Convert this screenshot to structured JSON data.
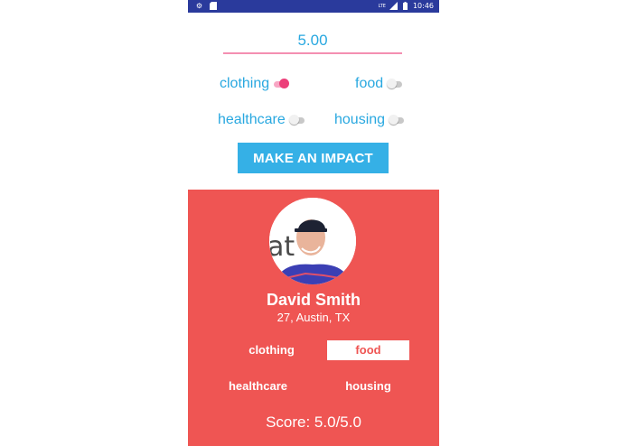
{
  "status_bar": {
    "time": "10:46",
    "left_icons": [
      "gear-icon",
      "sd-card-icon"
    ],
    "right_icons": [
      "lte-signal-icon",
      "battery-icon"
    ],
    "network_label": "LTE"
  },
  "form": {
    "amount_value": "5.00",
    "toggles": [
      {
        "label": "clothing",
        "on": true
      },
      {
        "label": "food",
        "on": false
      },
      {
        "label": "healthcare",
        "on": false
      },
      {
        "label": "housing",
        "on": false
      }
    ],
    "submit_label": "MAKE AN IMPACT"
  },
  "profile": {
    "avatar_icon": "profile-photo",
    "name": "David Smith",
    "details": "27, Austin, TX",
    "categories": [
      {
        "label": "clothing",
        "selected": false
      },
      {
        "label": "food",
        "selected": true
      },
      {
        "label": "healthcare",
        "selected": false
      },
      {
        "label": "housing",
        "selected": false
      }
    ],
    "score": "Score: 5.0/5.0"
  },
  "colors": {
    "status_bar": "#2a3a9c",
    "accent_blue": "#29a8e0",
    "button_blue": "#35b0e6",
    "switch_pink": "#ec407a",
    "card_red": "#ef5553"
  }
}
